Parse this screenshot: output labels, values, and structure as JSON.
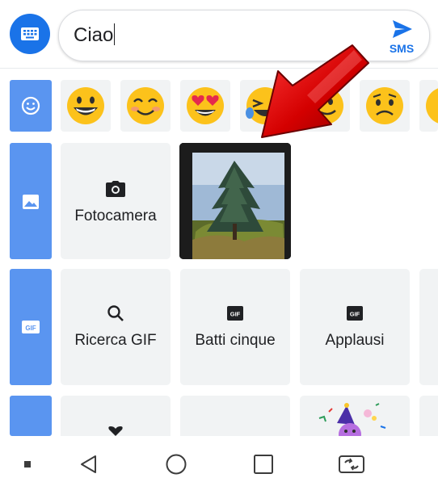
{
  "compose": {
    "input_value": "Ciao",
    "send_label": "SMS",
    "accent": "#1a73e8"
  },
  "panel": {
    "category_color": "#5a95f0",
    "categories": [
      {
        "name": "emoji-category",
        "icon": "smiley-icon"
      },
      {
        "name": "gallery-category",
        "icon": "image-icon"
      },
      {
        "name": "gif-category",
        "icon": "gif-icon"
      },
      {
        "name": "stickers-category",
        "icon": "sticker-icon"
      }
    ],
    "emoji_row": [
      "grinning-face",
      "smiling-face-blush",
      "heart-eyes-face",
      "laughing-tears-face",
      "partial-face",
      "worried-face",
      "partial-face"
    ],
    "media_row": {
      "camera_label": "Fotocamera",
      "camera_icon": "camera-icon",
      "photo_thumbnail": "pine-tree-photo"
    },
    "gif_row": [
      {
        "label": "Ricerca GIF",
        "icon": "search-icon"
      },
      {
        "label": "Batti cinque",
        "icon": "gif-icon"
      },
      {
        "label": "Applausi",
        "icon": "gif-icon"
      }
    ],
    "overlay": {
      "type": "red-arrow-annotation",
      "color": "#d40000"
    }
  },
  "navbar": {
    "items": [
      "dot-icon",
      "back-icon",
      "home-icon",
      "recents-icon",
      "switch-sim-icon"
    ]
  }
}
